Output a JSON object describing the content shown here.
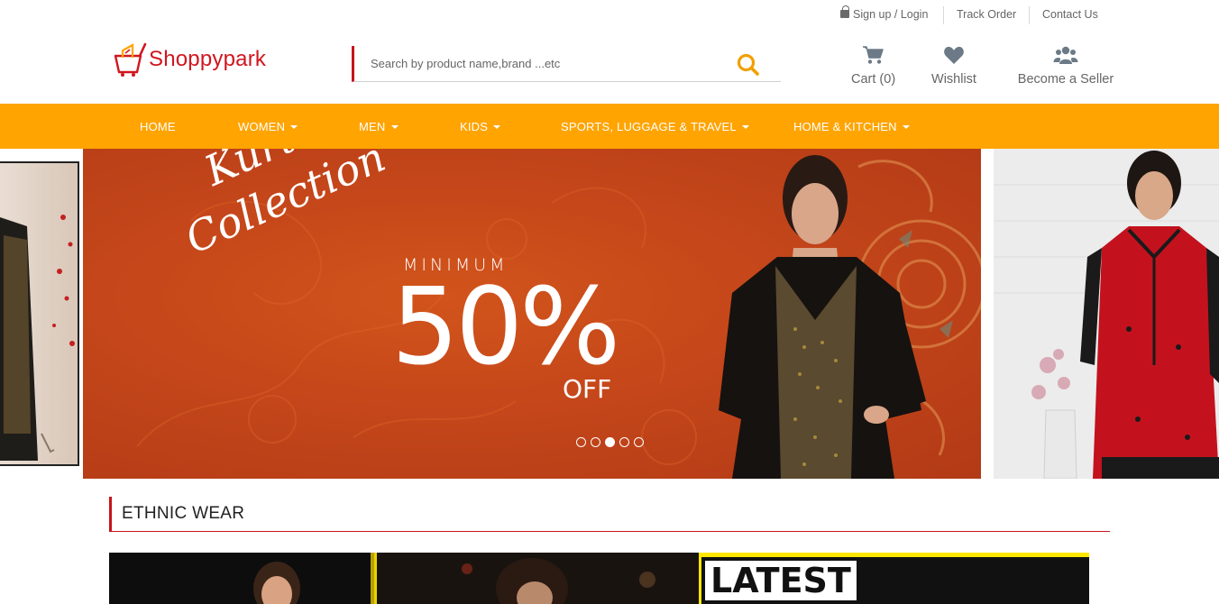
{
  "top_links": {
    "login": "Sign up / Login",
    "track_order": "Track Order",
    "contact_us": "Contact Us"
  },
  "brand": {
    "name": "Shoppypark"
  },
  "search": {
    "placeholder": "Search by product name,brand ...etc"
  },
  "header_actions": {
    "cart": "Cart (0)",
    "wishlist": "Wishlist",
    "seller": "Become a Seller"
  },
  "nav": {
    "items": [
      {
        "label": "HOME",
        "dropdown": false
      },
      {
        "label": "WOMEN",
        "dropdown": true
      },
      {
        "label": "MEN",
        "dropdown": true
      },
      {
        "label": "KIDS",
        "dropdown": true
      },
      {
        "label": "SPORTS, LUGGAGE & TRAVEL",
        "dropdown": true
      },
      {
        "label": "HOME & KITCHEN",
        "dropdown": true
      }
    ]
  },
  "banner": {
    "script_line1": "Kurtis",
    "script_line2": "Collection",
    "minimum": "MINIMUM",
    "percent": "50%",
    "off": "OFF",
    "slide_count": 5,
    "active_slide": 3
  },
  "section": {
    "title": "ETHNIC WEAR"
  },
  "tiles": {
    "latest_label": "LATEST"
  },
  "colors": {
    "accent_red": "#c7141b",
    "nav_orange": "#ffa400",
    "banner_orange": "#c4461a",
    "search_icon": "#f0a000"
  }
}
